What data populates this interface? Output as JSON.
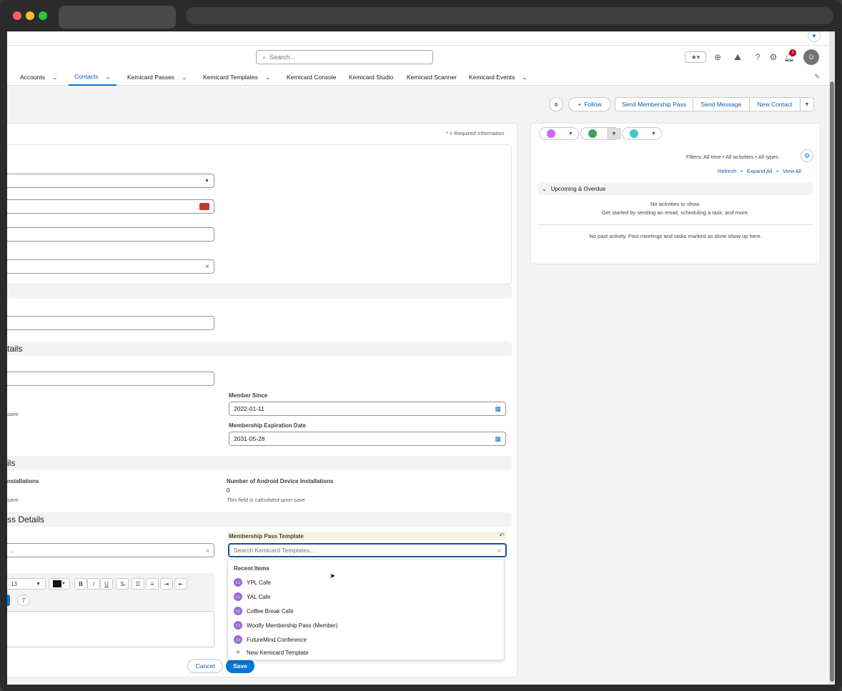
{
  "search": {
    "placeholder": "Search..."
  },
  "notification_count": "1",
  "nav": {
    "items": [
      {
        "label": "Accounts"
      },
      {
        "label": "Contacts"
      },
      {
        "label": "Kemicard Passes"
      },
      {
        "label": "Kemicard Templates"
      },
      {
        "label": "Kemicard Console"
      },
      {
        "label": "Kemicard Studio"
      },
      {
        "label": "Kemicard Scanner"
      },
      {
        "label": "Kemicard Events"
      }
    ]
  },
  "actions": {
    "follow": "Follow",
    "send_membership_pass": "Send Membership Pass",
    "send_message": "Send Message",
    "new_contact": "New Contact"
  },
  "form": {
    "required_info": "* = Required Information",
    "section_details_partial": "tails",
    "section_ils_partial": "ils",
    "section_pass_details_partial": "ss Details",
    "member_since_label": "Member Since",
    "member_since_value": "2022-01-11",
    "membership_expiration_label": "Membership Expiration Date",
    "membership_expiration_value": "2031-05-28",
    "save_note_1": "save",
    "installations_partial": "nstallations",
    "android_installations_label": "Number of Android Device Installations",
    "android_installations_value": "0",
    "calculated_note": "This field is calculated upon save",
    "save_note_2": "save",
    "membership_pass_template_label": "Membership Pass Template",
    "template_search_placeholder": "Search Kemicard Templates...",
    "font_size": "13",
    "cancel": "Cancel",
    "save": "Save"
  },
  "dropdown": {
    "header": "Recent Items",
    "items": [
      {
        "label": "YPL Cafe"
      },
      {
        "label": "YAL Cafe"
      },
      {
        "label": "Coffee Break Cafe"
      },
      {
        "label": "Woofly Membership Pass (Member)"
      },
      {
        "label": "FutureMind Conference"
      }
    ],
    "new_label": "New Kemicard Template"
  },
  "activity": {
    "filters": "Filters: All time • All activities • All types",
    "refresh": "Refresh",
    "expand_all": "Expand All",
    "view_all": "View All",
    "upcoming": "Upcoming & Overdue",
    "no_activities": "No activities to show.",
    "get_started": "Get started by sending an email, scheduling a task, and more.",
    "no_past": "No past activity. Past meetings and tasks marked as done show up here."
  }
}
